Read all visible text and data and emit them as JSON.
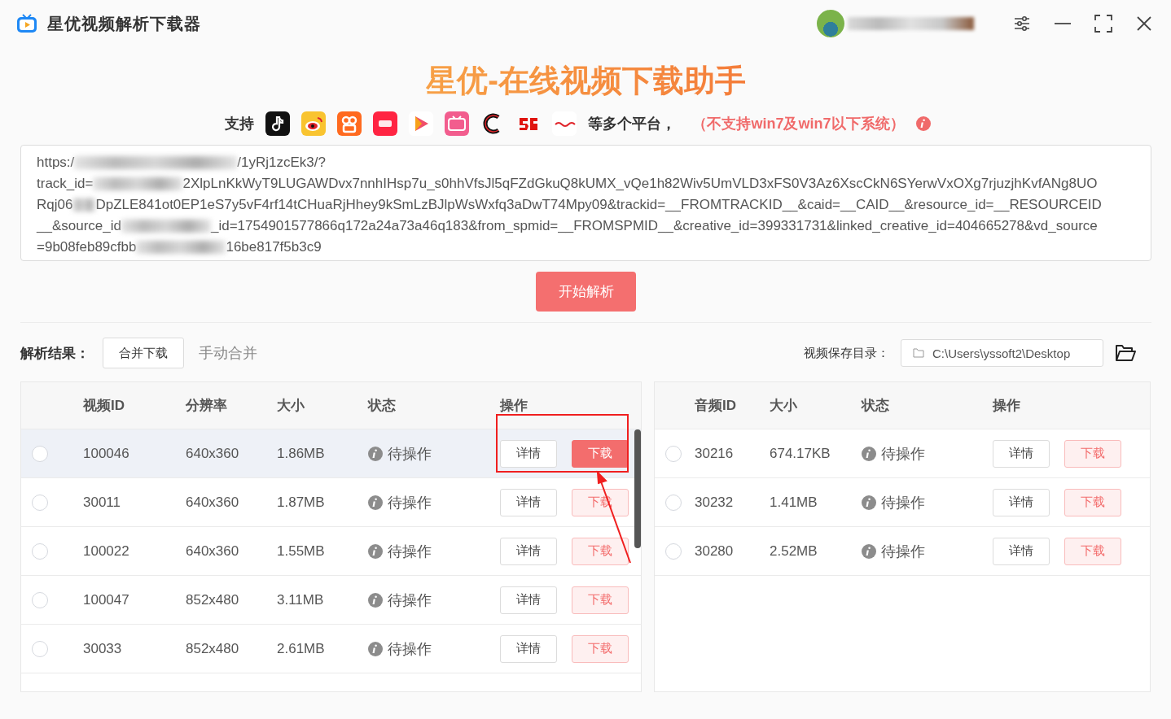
{
  "window": {
    "title": "星优视频解析下载器"
  },
  "header": {
    "heading": "星优-在线视频下载助手",
    "support_label": "支持",
    "platforms_suffix": "等多个平台，",
    "notice": "（不支持win7及win7以下系统）"
  },
  "url_input": {
    "lines": [
      [
        {
          "kind": "text",
          "text": "https:/"
        },
        {
          "kind": "blur_long"
        },
        {
          "kind": "text",
          "text": "/1yRj1zcEk3/?"
        }
      ],
      [
        {
          "kind": "text",
          "text": "track_id="
        },
        {
          "kind": "blur"
        },
        {
          "kind": "text",
          "text": "2XlpLnKkWyT9LUGAWDvx7nnhIHsp7u_s0hhVfsJl5qFZdGkuQ8kUMX_vQe1h82Wiv5UmVLD3xFS0V3Az6XscCkN6SYerwVxOXg7rjuzjhKvfANg8UO"
        }
      ],
      [
        {
          "kind": "text",
          "text": "Rqj06"
        },
        {
          "kind": "blur_short"
        },
        {
          "kind": "text",
          "text": "DpZLE841ot0EP1eS7y5vF4rf14tCHuaRjHhey9kSmLzBJlpWsWxfq3aDwT74Mpy09&trackid=__FROMTRACKID__&caid=__CAID__&resource_id=__RESOURCEID"
        }
      ],
      [
        {
          "kind": "text",
          "text": "__&source_id"
        },
        {
          "kind": "blur"
        },
        {
          "kind": "text",
          "text": "_id=1754901577866q172a24a73a46q183&from_spmid=__FROMSPMID__&creative_id=399331731&linked_creative_id=404665278&vd_source"
        }
      ],
      [
        {
          "kind": "text",
          "text": "=9b08feb89cfbb"
        },
        {
          "kind": "blur"
        },
        {
          "kind": "text",
          "text": "16be817f5b3c9"
        }
      ]
    ]
  },
  "parse_button": "开始解析",
  "results": {
    "label": "解析结果：",
    "merge_button": "合并下载",
    "manual_merge": "手动合并",
    "save_dir_label": "视频保存目录：",
    "save_dir": "C:\\Users\\yssoft2\\Desktop"
  },
  "video_table": {
    "columns": [
      "视频ID",
      "分辨率",
      "大小",
      "状态",
      "操作"
    ],
    "rows": [
      {
        "id": "100046",
        "resolution": "640x360",
        "size": "1.86MB",
        "status": "待操作",
        "selected": false,
        "hovered": true,
        "details": "详情",
        "download": "下载",
        "download_active": true
      },
      {
        "id": "30011",
        "resolution": "640x360",
        "size": "1.87MB",
        "status": "待操作",
        "selected": false,
        "hovered": false,
        "details": "详情",
        "download": "下载",
        "download_active": false
      },
      {
        "id": "100022",
        "resolution": "640x360",
        "size": "1.55MB",
        "status": "待操作",
        "selected": false,
        "hovered": false,
        "details": "详情",
        "download": "下载",
        "download_active": false
      },
      {
        "id": "100047",
        "resolution": "852x480",
        "size": "3.11MB",
        "status": "待操作",
        "selected": false,
        "hovered": false,
        "details": "详情",
        "download": "下载",
        "download_active": false
      },
      {
        "id": "30033",
        "resolution": "852x480",
        "size": "2.61MB",
        "status": "待操作",
        "selected": false,
        "hovered": false,
        "details": "详情",
        "download": "下载",
        "download_active": false
      }
    ]
  },
  "audio_table": {
    "columns": [
      "音频ID",
      "大小",
      "状态",
      "操作"
    ],
    "rows": [
      {
        "id": "30216",
        "size": "674.17KB",
        "status": "待操作",
        "selected": false,
        "hovered": false,
        "details": "详情",
        "download": "下载",
        "download_active": false
      },
      {
        "id": "30232",
        "size": "1.41MB",
        "status": "待操作",
        "selected": false,
        "hovered": false,
        "details": "详情",
        "download": "下载",
        "download_active": false
      },
      {
        "id": "30280",
        "size": "2.52MB",
        "status": "待操作",
        "selected": false,
        "hovered": false,
        "details": "详情",
        "download": "下载",
        "download_active": false
      }
    ]
  }
}
